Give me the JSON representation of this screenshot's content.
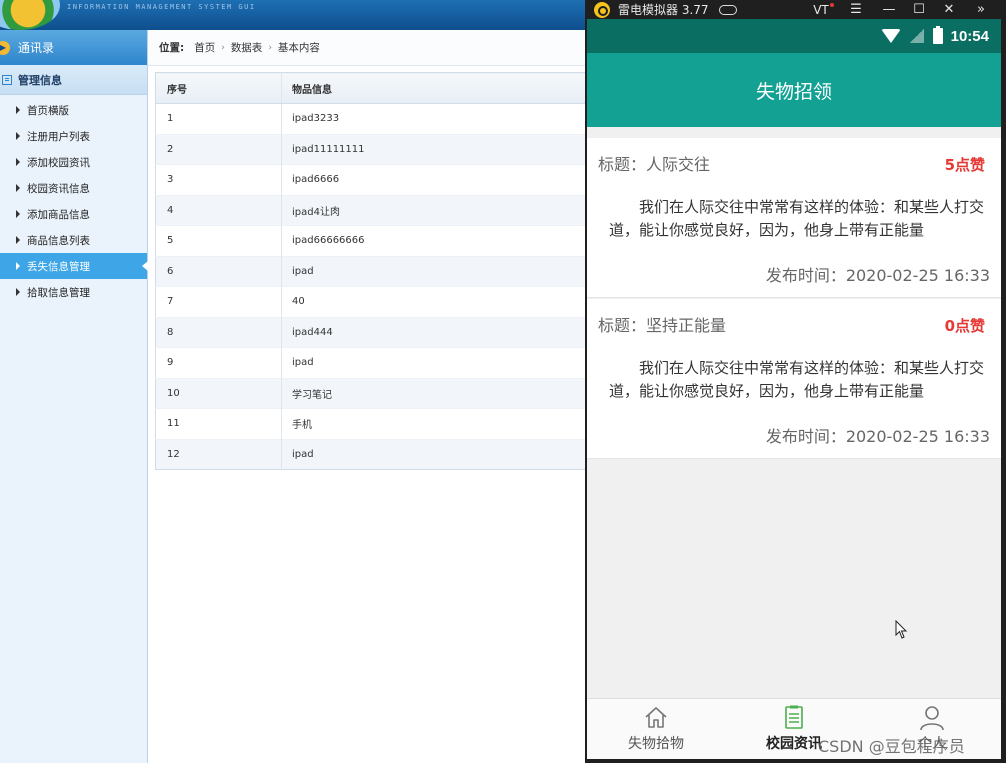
{
  "admin": {
    "header_subtitle": "INFORMATION MANAGEMENT SYSTEM GUI",
    "sidebar": {
      "contacts_label": "通讯录",
      "manage_label": "管理信息",
      "items": [
        {
          "label": "首页横版"
        },
        {
          "label": "注册用户列表"
        },
        {
          "label": "添加校园资讯"
        },
        {
          "label": "校园资讯信息"
        },
        {
          "label": "添加商品信息"
        },
        {
          "label": "商品信息列表"
        },
        {
          "label": "丢失信息管理",
          "active": true
        },
        {
          "label": "拾取信息管理"
        }
      ]
    },
    "breadcrumb": {
      "label": "位置:",
      "items": [
        "首页",
        "数据表",
        "基本内容"
      ]
    },
    "table": {
      "headers": [
        "序号",
        "物品信息"
      ],
      "rows": [
        [
          "1",
          "ipad3233"
        ],
        [
          "2",
          "ipad11111111"
        ],
        [
          "3",
          "ipad6666"
        ],
        [
          "4",
          "ipad4让肉"
        ],
        [
          "5",
          "ipad66666666"
        ],
        [
          "6",
          "ipad"
        ],
        [
          "7",
          "40"
        ],
        [
          "8",
          "ipad444"
        ],
        [
          "9",
          "ipad"
        ],
        [
          "10",
          "学习笔记"
        ],
        [
          "11",
          "手机"
        ],
        [
          "12",
          "ipad"
        ]
      ]
    }
  },
  "emulator": {
    "title": "雷电模拟器 3.77",
    "vt_label": "VT",
    "status_time": "10:54",
    "app_title": "失物招领",
    "cards": [
      {
        "title": "标题：人际交往",
        "likes": "5点赞",
        "body": "我们在人际交往中常常有这样的体验：和某些人打交道，能让你感觉良好，因为，他身上带有正能量",
        "time": "发布时间：2020-02-25 16:33"
      },
      {
        "title": "标题：坚持正能量",
        "likes": "0点赞",
        "body": "我们在人际交往中常常有这样的体验：和某些人打交道，能让你感觉良好，因为，他身上带有正能量",
        "time": "发布时间：2020-02-25 16:33"
      }
    ],
    "nav": [
      {
        "label": "失物拾物",
        "icon": "home-icon"
      },
      {
        "label": "校园资讯",
        "icon": "clipboard-icon",
        "active": true
      },
      {
        "label": "个人",
        "icon": "user-icon"
      }
    ]
  },
  "watermark": "CSDN @豆包程序员",
  "colors": {
    "app_bar": "#12a193",
    "status_bar": "#0b6e63",
    "likes": "#e53935",
    "active_sidebar": "#3ea6e6",
    "active_nav_icon": "#4caf50"
  }
}
